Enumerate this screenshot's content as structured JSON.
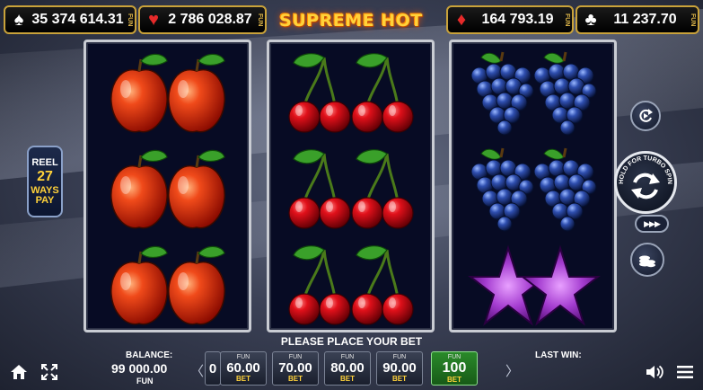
{
  "jackpots": [
    {
      "suit": "spade-icon",
      "value": "35 374 614.31",
      "currency": "FUN"
    },
    {
      "suit": "heart-icon",
      "value": "2 786 028.87",
      "currency": "FUN"
    },
    {
      "suit": "diamond-icon",
      "value": "164 793.19",
      "currency": "FUN"
    },
    {
      "suit": "club-icon",
      "value": "11 237.70",
      "currency": "FUN"
    }
  ],
  "game_title": "SUPREME HOT",
  "reel_info": {
    "line1": "REEL",
    "line2": "27",
    "line3": "WAYS",
    "line4": "PAY"
  },
  "reels": [
    [
      "apple",
      "apple",
      "apple"
    ],
    [
      "cherry",
      "cherry",
      "cherry"
    ],
    [
      "grape",
      "grape",
      "star"
    ]
  ],
  "spin_button": {
    "hint": "HOLD FOR TURBO SPIN"
  },
  "status_message": "PLEASE PLACE YOUR BET",
  "balance": {
    "label": "BALANCE:",
    "value": "99 000.00",
    "currency": "FUN"
  },
  "bets": [
    {
      "currency": "FUN",
      "amount": "60.00",
      "label": "BET"
    },
    {
      "currency": "FUN",
      "amount": "70.00",
      "label": "BET"
    },
    {
      "currency": "FUN",
      "amount": "80.00",
      "label": "BET"
    },
    {
      "currency": "FUN",
      "amount": "90.00",
      "label": "BET"
    },
    {
      "currency": "FUN",
      "amount": "100",
      "label": "BET",
      "active": true
    }
  ],
  "bet_partial_left": "0",
  "last_win_label": "LAST WIN:",
  "colors": {
    "accent_gold": "#ffd23a",
    "active_bet": "#2a8a2a",
    "reel_bg": "#070b24"
  }
}
